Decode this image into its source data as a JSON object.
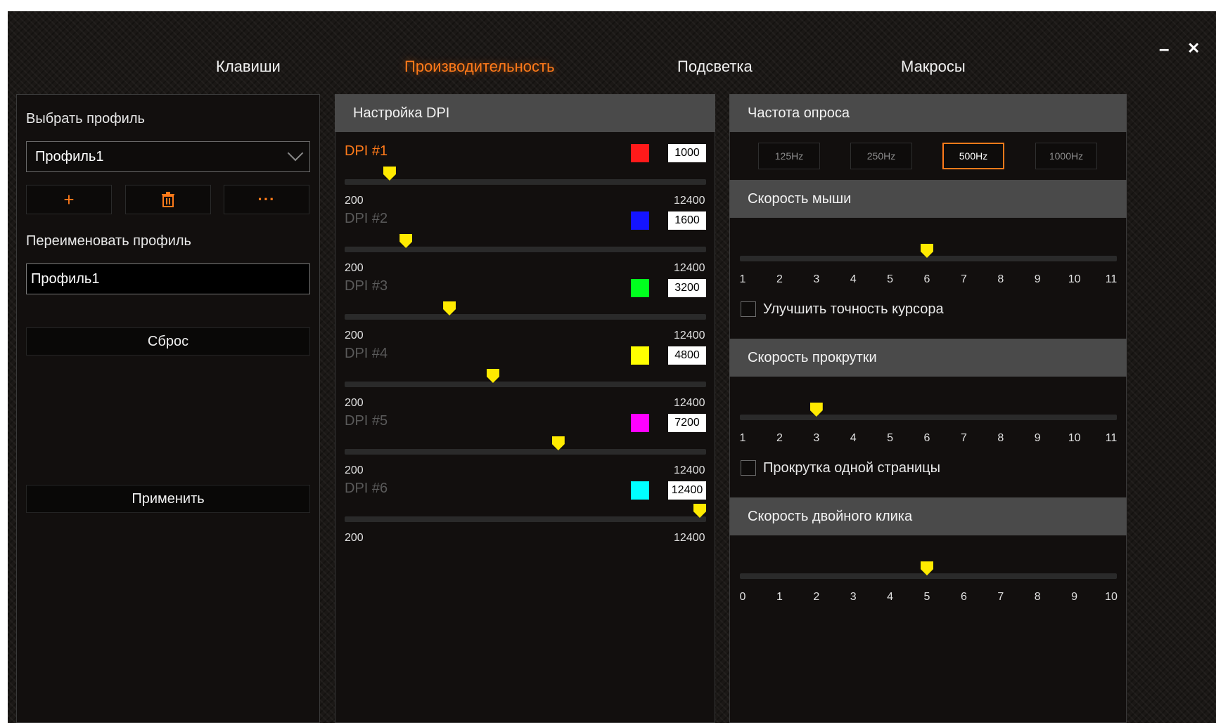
{
  "window": {
    "minimize_icon": "minimize-icon",
    "close_icon": "close-icon",
    "minimize": "–",
    "close": "✕"
  },
  "tabs": [
    {
      "label": "Клавиши"
    },
    {
      "label": "Производительность",
      "active": true
    },
    {
      "label": "Подсветка"
    },
    {
      "label": "Макросы"
    }
  ],
  "profile": {
    "select_label": "Выбрать профиль",
    "selected": "Профиль1",
    "add_icon": "+",
    "delete_icon": "🗑",
    "more_icon": "···",
    "rename_label": "Переименовать профиль",
    "rename_value": "Профиль1",
    "reset_label": "Сброс",
    "apply_label": "Применить"
  },
  "dpi": {
    "header": "Настройка DPI",
    "min_label": "200",
    "max_label": "12400",
    "min": 200,
    "max": 12400,
    "levels": [
      {
        "name": "DPI #1",
        "value": "1000",
        "color": "#ff1a1a",
        "active": true
      },
      {
        "name": "DPI #2",
        "value": "1600",
        "color": "#1414ff",
        "active": false
      },
      {
        "name": "DPI #3",
        "value": "3200",
        "color": "#00ff1e",
        "active": false
      },
      {
        "name": "DPI #4",
        "value": "4800",
        "color": "#ffff00",
        "active": false
      },
      {
        "name": "DPI #5",
        "value": "7200",
        "color": "#ff00ff",
        "active": false
      },
      {
        "name": "DPI #6",
        "value": "12400",
        "color": "#00ffff",
        "active": false
      }
    ]
  },
  "polling": {
    "header": "Частота опроса",
    "options": [
      "125Hz",
      "250Hz",
      "500Hz",
      "1000Hz"
    ],
    "selected_index": 2
  },
  "mouse_speed": {
    "header": "Скорость мыши",
    "ticks": [
      "1",
      "2",
      "3",
      "4",
      "5",
      "6",
      "7",
      "8",
      "9",
      "10",
      "11"
    ],
    "value": 6,
    "checkbox_label": "Улучшить точность курсора"
  },
  "scroll_speed": {
    "header": "Скорость прокрутки",
    "ticks": [
      "1",
      "2",
      "3",
      "4",
      "5",
      "6",
      "7",
      "8",
      "9",
      "10",
      "11"
    ],
    "value": 3,
    "checkbox_label": "Прокрутка одной страницы"
  },
  "double_click": {
    "header": "Скорость двойного клика",
    "ticks": [
      "0",
      "1",
      "2",
      "3",
      "4",
      "5",
      "6",
      "7",
      "8",
      "9",
      "10"
    ],
    "value": 5
  },
  "colors": {
    "accent": "#ff7a1a",
    "thumb": "#ffea00",
    "header_bg": "#4a4a4a"
  }
}
